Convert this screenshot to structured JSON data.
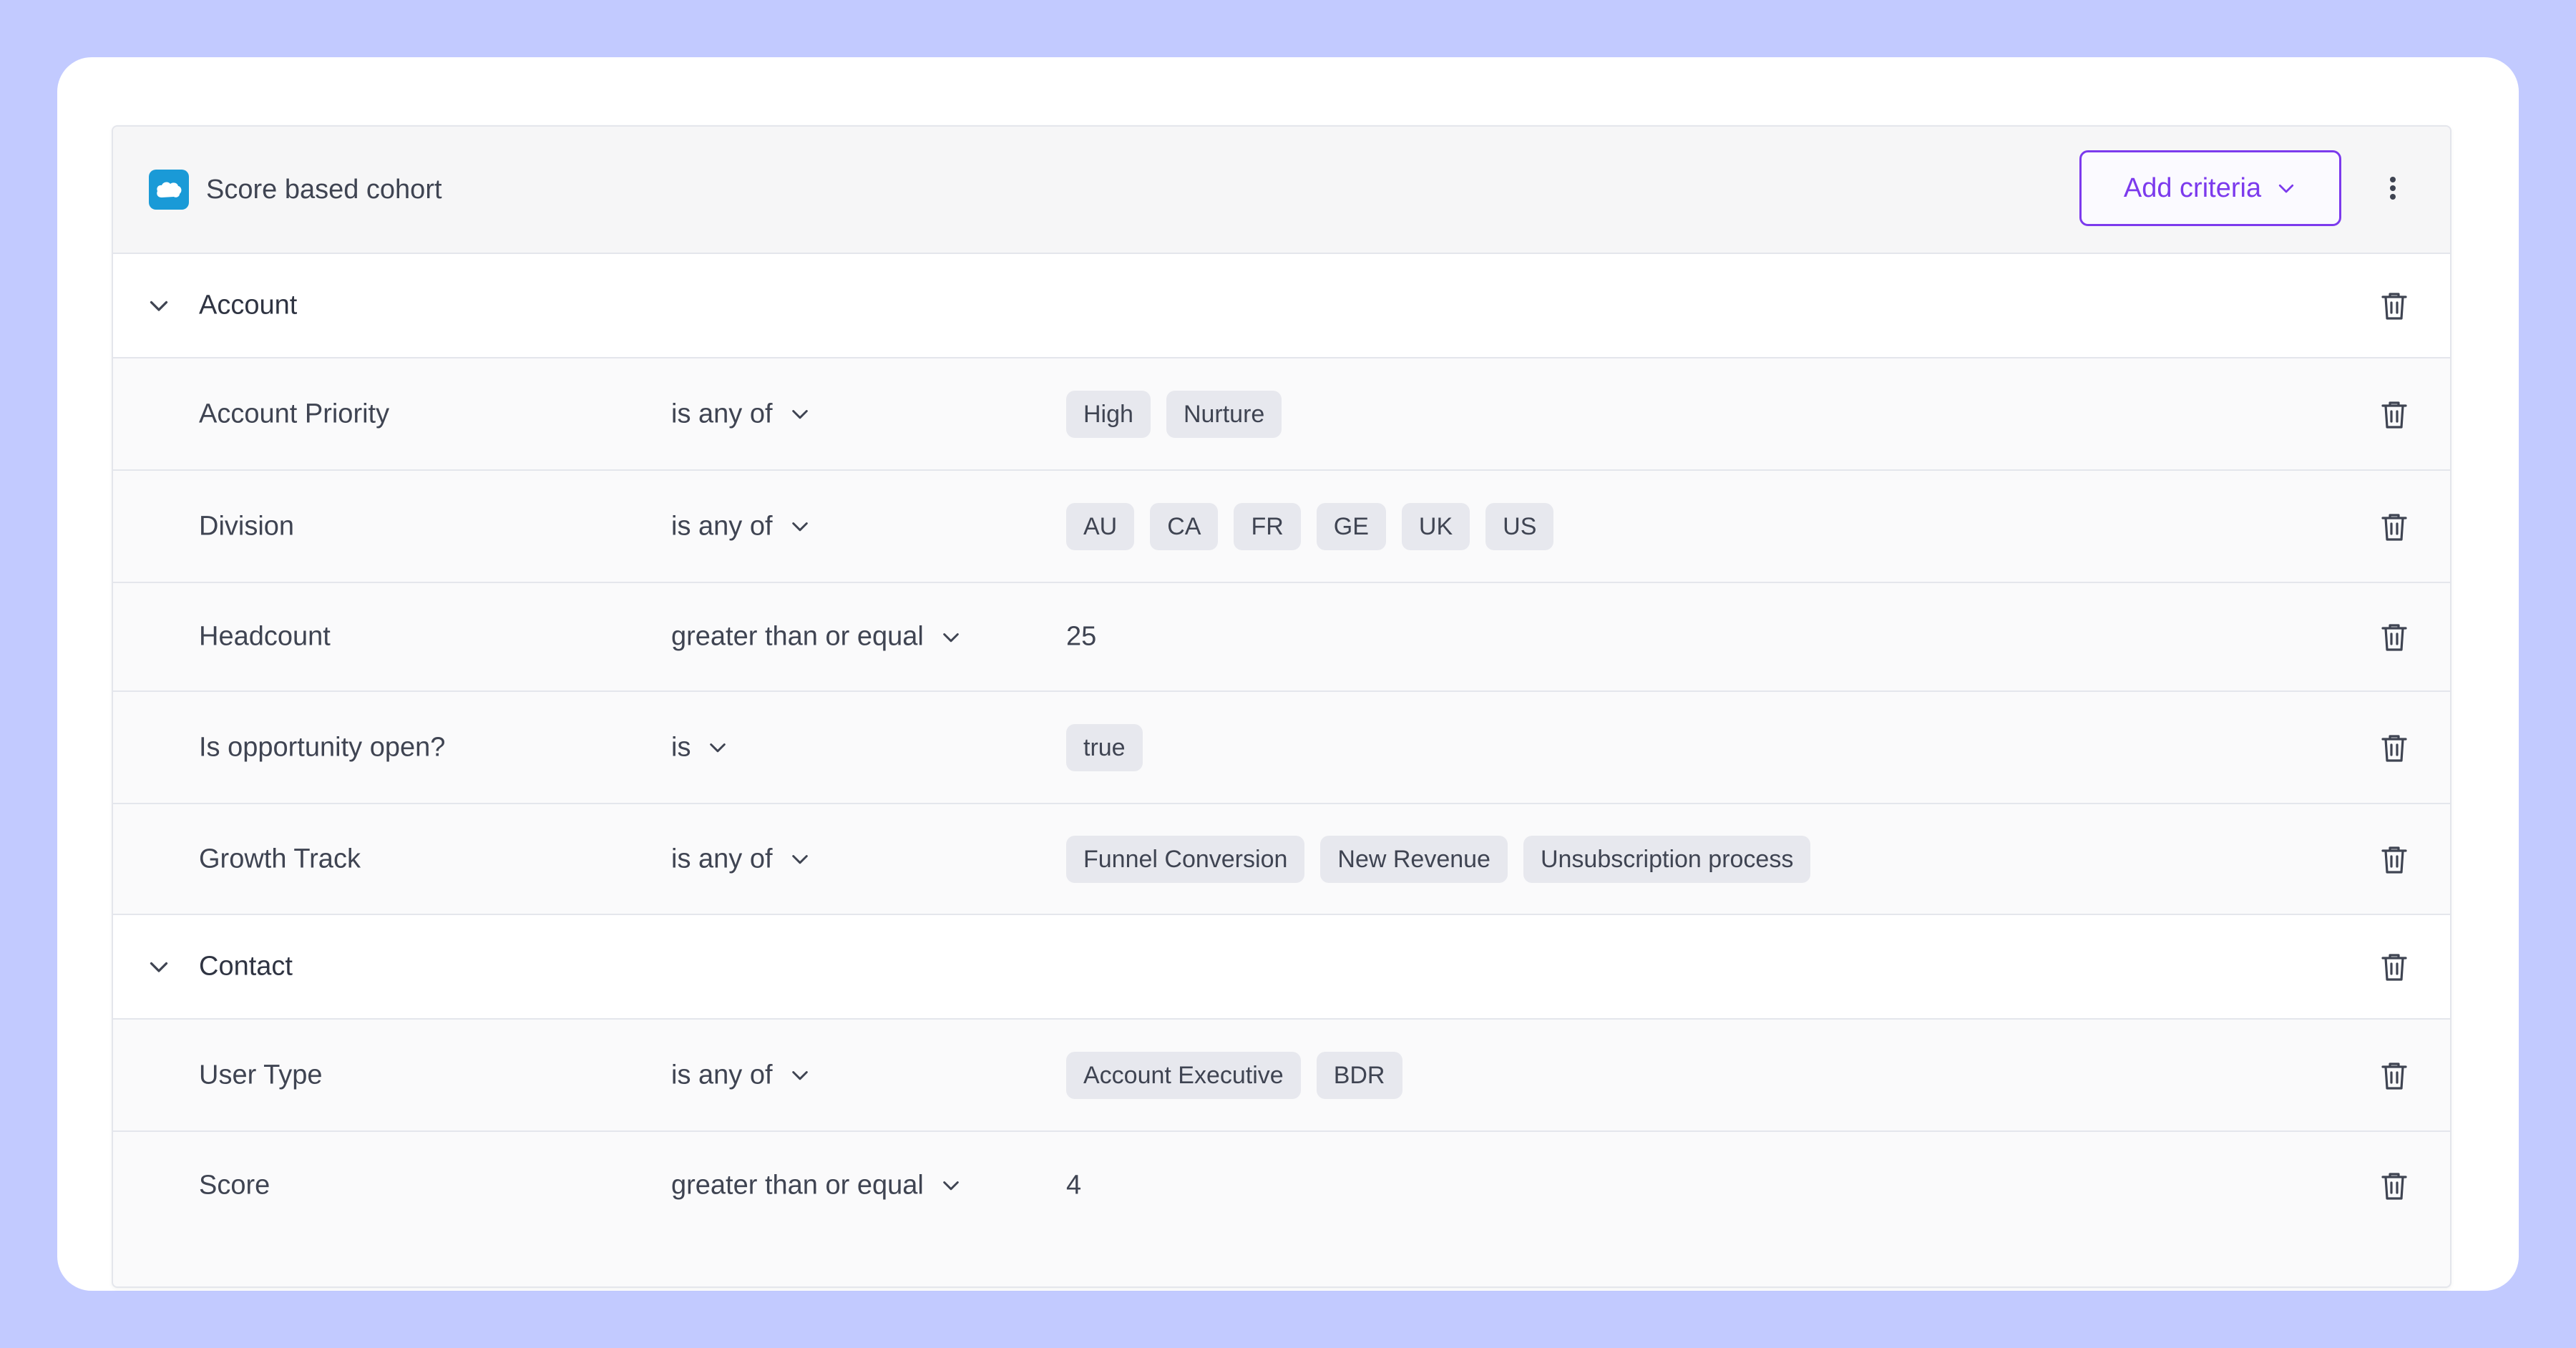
{
  "header": {
    "title": "Score based cohort",
    "add_criteria_label": "Add criteria",
    "logo_icon": "salesforce-cloud-icon",
    "accent_color": "#7c3aed",
    "logo_color": "#1a9ad7"
  },
  "groups": [
    {
      "label": "Account",
      "criteria": [
        {
          "field": "Account Priority",
          "operator": "is any of",
          "values": [
            "High",
            "Nurture"
          ]
        },
        {
          "field": "Division",
          "operator": "is any of",
          "values": [
            "AU",
            "CA",
            "FR",
            "GE",
            "UK",
            "US"
          ]
        },
        {
          "field": "Headcount",
          "operator": "greater than or equal",
          "value": "25"
        },
        {
          "field": "Is opportunity open?",
          "operator": "is",
          "values": [
            "true"
          ]
        },
        {
          "field": "Growth Track",
          "operator": "is any of",
          "values": [
            "Funnel Conversion",
            "New Revenue",
            "Unsubscription process"
          ]
        }
      ]
    },
    {
      "label": "Contact",
      "criteria": [
        {
          "field": "User Type",
          "operator": "is any of",
          "values": [
            "Account Executive",
            "BDR"
          ]
        },
        {
          "field": "Score",
          "operator": "greater than or equal",
          "value": "4"
        }
      ]
    }
  ]
}
